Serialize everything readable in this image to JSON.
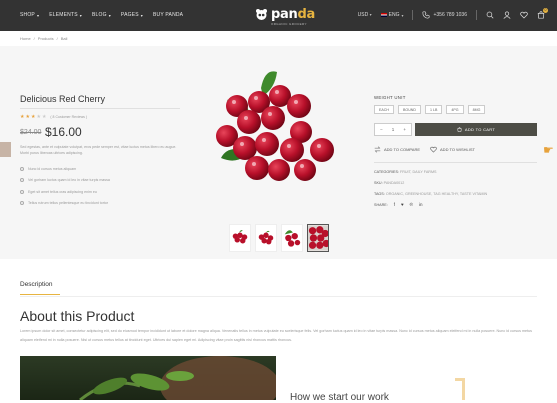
{
  "nav": {
    "items": [
      {
        "label": "SHOP",
        "has_menu": true
      },
      {
        "label": "ELEMENTS",
        "has_menu": true
      },
      {
        "label": "BLOG",
        "has_menu": true
      },
      {
        "label": "PAGES",
        "has_menu": true
      },
      {
        "label": "BUY PANDA",
        "has_menu": false
      }
    ],
    "logo": {
      "pan": "pan",
      "da": "da",
      "tagline": "ORGANIC GROCERY"
    },
    "currency": "USD",
    "language": "ENG",
    "phone": "+356 789 1036",
    "cart_count": "0"
  },
  "breadcrumb": [
    "Home",
    "Products",
    "Ball"
  ],
  "product": {
    "title": "Delicious Red Cherry",
    "rating": 3,
    "rating_max": 5,
    "review_text": "( 8 Customer Reviews )",
    "old_price": "$24.00",
    "price": "$16.00",
    "description": "Sed egestas, ante et vulputate volutpat, eros pede semper est, vitae luctus metus libero eu augue. Morbi purus liberoas ultrices adipiscing.",
    "features": [
      "Nunc id cursus metus aliquam",
      "Vel gorham luctus quam id leo in vitae turpis massa",
      "Eget sit amet tellus cras adipiscing enim eu",
      "Tellus rutrum tellus pellentesque eu tincidunt tortor"
    ]
  },
  "purchase": {
    "weight_label": "WEIGHT UNIT",
    "options": [
      "EACH",
      "BOUND",
      "1 LB",
      "4PG",
      "8MG"
    ],
    "qty_minus": "−",
    "qty": "1",
    "qty_plus": "+",
    "add_to_cart": "ADD TO CART",
    "compare": "ADD TO COMPARE",
    "wishlist": "ADD TO WISHLIST",
    "categories_label": "CATEGORIES:",
    "categories": "FRUIT, DAILY FARMS",
    "sku_label": "SKU:",
    "sku": "PANDA0012",
    "tags_label": "TAGS:",
    "tags": "ORGANIC, GREENHOUSE, TAG HEALTHY, TASTE VITAMIN",
    "share_label": "SHARE:"
  },
  "tabs": {
    "description": "Description"
  },
  "about": {
    "heading": "About this Product",
    "text": "Lorem ipsum dolor sit amet, consectetur adipiscing elit, sed do eiusmod tempor incididunt ut labore et dolore magna aliqua. Venenatis tellus in metus vulputate eu scelerisque felis. Vel gorham luctus quam id leo in vitae turpis massa. Nunc id cursus metus aliquam eleifend mi in nulla posuere. Nunc id cursus metus aliquam eleifend mi in nulla posuere. Nisi ut cursus metus tellus at tincidunt eget. Ultrices dui sapien eget mi. Adipiscing vitae proin sagittis nisl rhoncus mattis rhoncus.",
    "subheading": "How we start our work"
  },
  "colors": {
    "topbar": "#333333",
    "accent": "#e7b440",
    "cart_button": "#4d4d46",
    "cherry": "#b8102a"
  }
}
